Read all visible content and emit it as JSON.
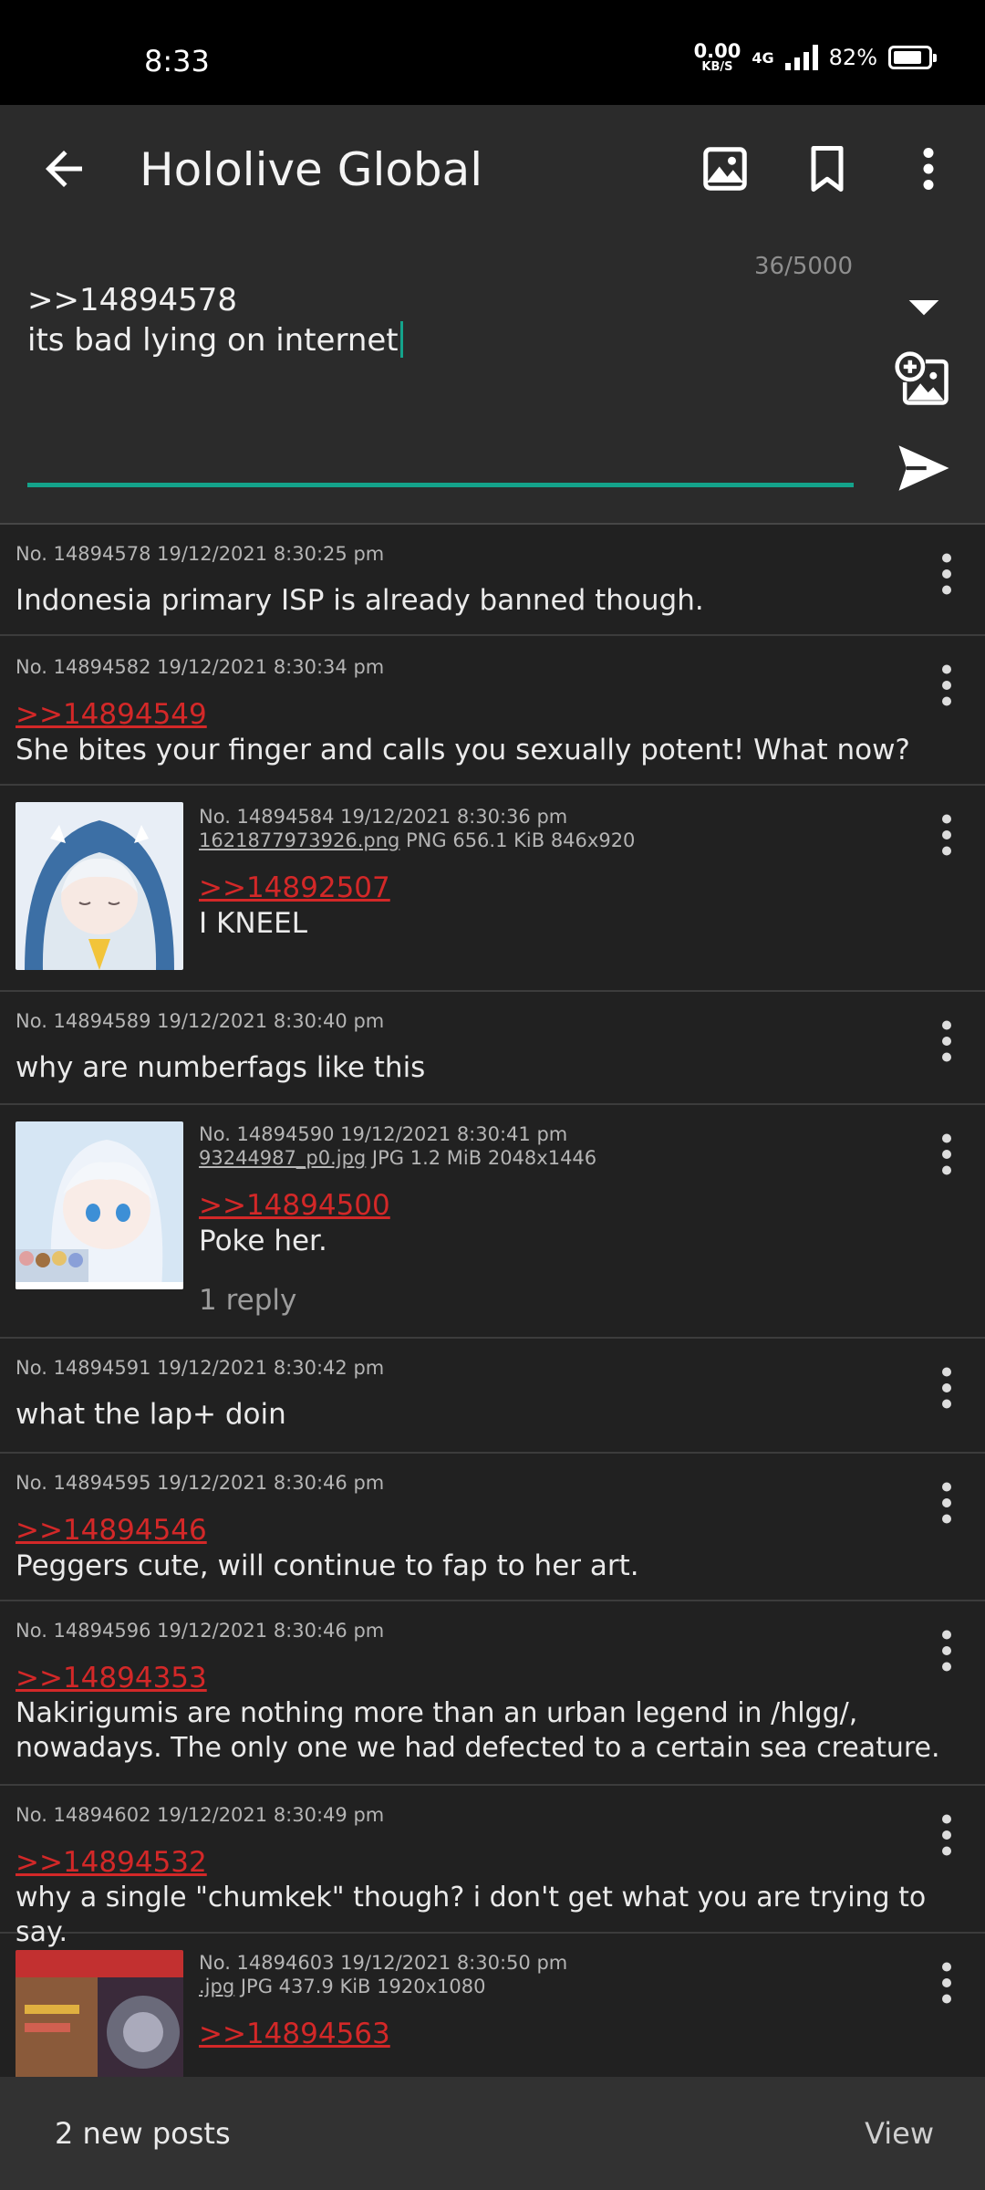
{
  "status_bar": {
    "time": "8:33",
    "net_speed": "0.00",
    "net_speed_unit": "KB/S",
    "network_type": "4G",
    "battery_percent": "82%",
    "battery_level": 0.82
  },
  "app_bar": {
    "title": "Hololive Global",
    "icons": [
      "back-arrow-icon",
      "image-icon",
      "bookmark-icon",
      "more-vert-icon"
    ]
  },
  "reply_box": {
    "counter": "36/5000",
    "text": ">>14894578\nits bad lying on internet",
    "accent_color": "#14a38b"
  },
  "posts": [
    {
      "meta": "No. 14894578 19/12/2021 8:30:25 pm",
      "quote": "",
      "body": "Indonesia primary ISP is already banned though."
    },
    {
      "meta": "No. 14894582 19/12/2021 8:30:34 pm",
      "quote": ">>14894549",
      "body": "She bites your finger and calls you sexually potent! What now?"
    },
    {
      "meta": "No. 14894584 19/12/2021 8:30:36 pm",
      "file_name": "1621877973926.png",
      "file_info": " PNG 656.1 KiB 846x920",
      "quote": ">>14892507",
      "body": "I KNEEL"
    },
    {
      "meta": "No. 14894589 19/12/2021 8:30:40 pm",
      "quote": "",
      "body": "why are numberfags like this"
    },
    {
      "meta": "No. 14894590 19/12/2021 8:30:41 pm",
      "file_name": "93244987_p0.jpg",
      "file_info": " JPG 1.2 MiB 2048x1446",
      "quote": ">>14894500",
      "body": "Poke her.",
      "replies": "1 reply"
    },
    {
      "meta": "No. 14894591 19/12/2021 8:30:42 pm",
      "quote": "",
      "body": "what the lap+ doin"
    },
    {
      "meta": "No. 14894595 19/12/2021 8:30:46 pm",
      "quote": ">>14894546",
      "body": "Peggers cute, will continue to fap to her art."
    },
    {
      "meta": "No. 14894596 19/12/2021 8:30:46 pm",
      "quote": ">>14894353",
      "body": "Nakirigumis are nothing more than an urban legend in /hlgg/, nowadays. The only one we had defected to a certain sea creature."
    },
    {
      "meta": "No. 14894602 19/12/2021 8:30:49 pm",
      "quote": ">>14894532",
      "body": "why a single \"chumkek\" though? i don't get what you are trying to say."
    },
    {
      "meta": "No. 14894603 19/12/2021 8:30:50 pm",
      "file_name": ".jpg",
      "file_info": " JPG 437.9 KiB 1920x1080",
      "quote": ">>14894563",
      "body": ""
    }
  ],
  "snackbar": {
    "message": "2 new posts",
    "action": "View"
  },
  "colors": {
    "background": "#212121",
    "toolbar": "#2b2b2b",
    "quote_link": "#d32828"
  }
}
